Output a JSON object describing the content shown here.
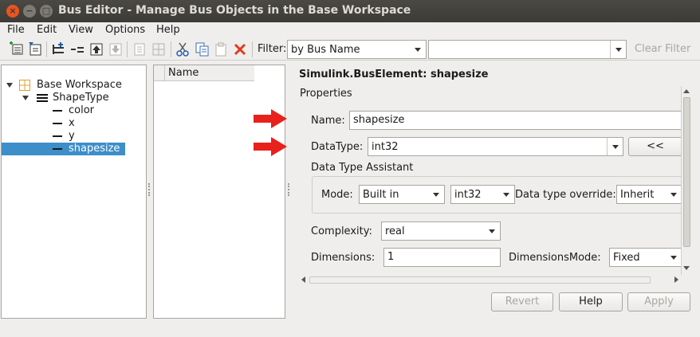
{
  "window": {
    "title": "Bus Editor - Manage Bus Objects in the Base Workspace",
    "close_glyph": "×",
    "min_glyph": "−",
    "max_glyph": "□"
  },
  "menu": {
    "file": "File",
    "edit": "Edit",
    "view": "View",
    "options": "Options",
    "help": "Help"
  },
  "toolbar": {
    "filter_label": "Filter:",
    "filter_type": "by Bus Name",
    "filter_text": "",
    "clear_filter": "Clear Filter",
    "icons": [
      "new-bus-icon",
      "import-icon",
      "add-element-icon",
      "remove-element-icon",
      "move-up-icon",
      "move-down-icon",
      "edit-icon",
      "grid-icon",
      "cut-icon",
      "copy-icon",
      "paste-icon",
      "delete-icon"
    ]
  },
  "tree": {
    "root": "Base Workspace",
    "bus": "ShapeType",
    "elements": [
      "color",
      "x",
      "y",
      "shapesize"
    ],
    "selected": "shapesize"
  },
  "list": {
    "header": "Name"
  },
  "properties": {
    "heading": "Simulink.BusElement: shapesize",
    "group": "Properties",
    "name_label": "Name:",
    "name_value": "shapesize",
    "datatype_label": "DataType:",
    "datatype_value": "int32",
    "datatype_button": "<<",
    "assistant_label": "Data Type Assistant",
    "mode_label": "Mode:",
    "mode_value": "Built in",
    "mode_type_value": "int32",
    "override_label": "Data type override:",
    "override_value": "Inherit",
    "complexity_label": "Complexity:",
    "complexity_value": "real",
    "dimensions_label": "Dimensions:",
    "dimensions_value": "1",
    "dimmode_label": "DimensionsMode:",
    "dimmode_value": "Fixed"
  },
  "buttons": {
    "revert": "Revert",
    "help": "Help",
    "apply": "Apply"
  },
  "colors": {
    "selection": "#3d8ec9",
    "arrow": "#e8211c",
    "delete_icon": "#e03a1e"
  }
}
